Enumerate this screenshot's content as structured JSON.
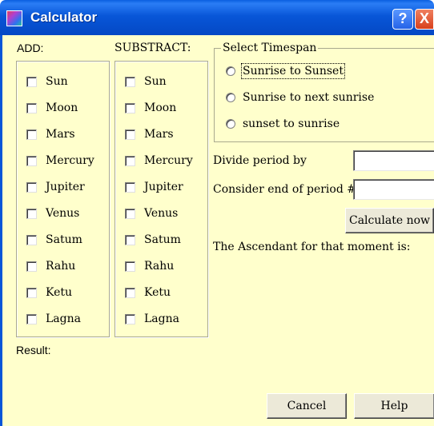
{
  "window": {
    "title": "Calculator",
    "help_glyph": "?",
    "close_glyph": "X"
  },
  "add": {
    "label": "ADD:",
    "items": [
      "Sun",
      "Moon",
      "Mars",
      "Mercury",
      "Jupiter",
      "Venus",
      "Satum",
      "Rahu",
      "Ketu",
      "Lagna"
    ]
  },
  "subtract": {
    "label": "SUBSTRACT:",
    "items": [
      "Sun",
      "Moon",
      "Mars",
      "Mercury",
      "Jupiter",
      "Venus",
      "Satum",
      "Rahu",
      "Ketu",
      "Lagna"
    ]
  },
  "timespan": {
    "label": "Select Timespan",
    "options": [
      "Sunrise to Sunset",
      "Sunrise to next sunrise",
      "sunset to sunrise"
    ],
    "selected": null
  },
  "divide": {
    "label": "Divide period by",
    "value": ""
  },
  "end_period": {
    "label": "Consider end of period #",
    "value": ""
  },
  "calculate_label": "Calculate now",
  "ascendant_text": "The Ascendant for that moment is:",
  "result_label": "Result:",
  "cancel_label": "Cancel",
  "help_label": "Help"
}
